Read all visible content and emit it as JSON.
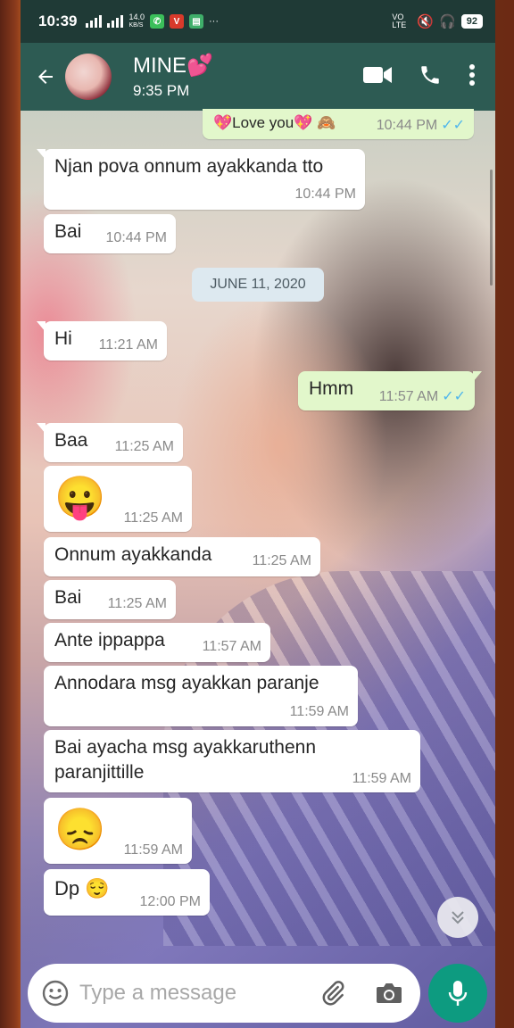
{
  "status_bar": {
    "time": "10:39",
    "net_speed_value": "14.0",
    "net_speed_unit": "KB/S",
    "network_label": "VO LTE",
    "battery": "92",
    "more": "···"
  },
  "header": {
    "contact_name": "MINE💕",
    "last_seen": "9:35 PM"
  },
  "messages": [
    {
      "text": "💖Love you💖 🙈",
      "time": "10:44 PM",
      "ticks": "✓✓"
    },
    {
      "text": "Njan pova onnum ayakkanda tto",
      "time": "10:44 PM"
    },
    {
      "text": "Bai",
      "time": "10:44 PM"
    },
    {
      "text": "Hi",
      "time": "11:21 AM"
    },
    {
      "text": "Hmm",
      "time": "11:57 AM",
      "ticks": "✓✓"
    },
    {
      "text": "Baa",
      "time": "11:25 AM"
    },
    {
      "text": "😛",
      "time": "11:25 AM"
    },
    {
      "text": "Onnum ayakkanda",
      "time": "11:25 AM"
    },
    {
      "text": "Bai",
      "time": "11:25 AM"
    },
    {
      "text": "Ante ippappa",
      "time": "11:57 AM"
    },
    {
      "text": "Annodara msg ayakkan paranje",
      "time": "11:59 AM"
    },
    {
      "text_line1": "Bai ayacha msg ayakkaruthenn",
      "text_line2": "paranjittille",
      "time": "11:59 AM"
    },
    {
      "text": "😞",
      "time": "11:59 AM"
    },
    {
      "text": "Dp 😌",
      "time": "12:00 PM"
    }
  ],
  "date_divider": "JUNE 11, 2020",
  "composer": {
    "placeholder": "Type a message"
  },
  "colors": {
    "header": "#2d5b53",
    "outgoing_bubble": "#e2f7cb",
    "incoming_bubble": "#ffffff",
    "mic_button": "#0d9b80",
    "read_ticks": "#4fb6ec"
  }
}
